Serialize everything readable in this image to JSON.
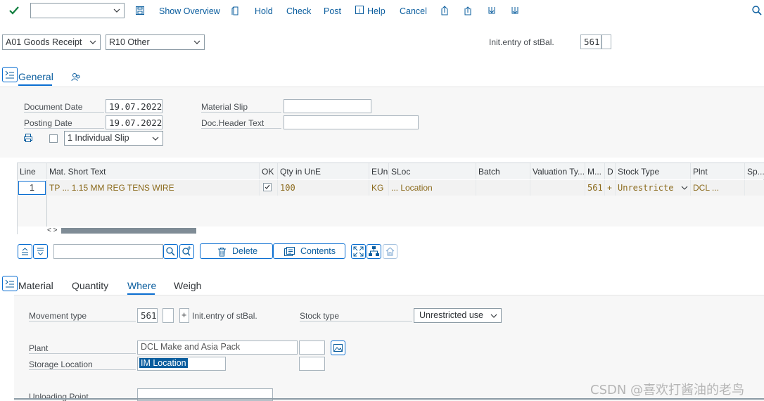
{
  "toolbar": {
    "show_overview": "Show Overview",
    "hold": "Hold",
    "check": "Check",
    "post": "Post",
    "help": "Help",
    "cancel": "Cancel"
  },
  "header": {
    "transaction": "A01 Goods Receipt",
    "reference": "R10 Other",
    "init_entry_label": "Init.entry of stBal.",
    "movement_type": "561"
  },
  "general_tab": {
    "label": "General",
    "document_date_label": "Document Date",
    "document_date": "19.07.2022",
    "posting_date_label": "Posting Date",
    "posting_date": "19.07.2022",
    "material_slip_label": "Material Slip",
    "doc_header_text_label": "Doc.Header Text",
    "slip_option": "1 Individual Slip"
  },
  "grid": {
    "columns": [
      "Line",
      "Mat. Short Text",
      "OK",
      "Qty in UnE",
      "EUn",
      "SLoc",
      "Batch",
      "Valuation Ty...",
      "M...",
      "D",
      "Stock Type",
      "Plnt",
      "Sp..."
    ],
    "row": {
      "line": "1",
      "short_text": "TP ... 1.15 MM REG TENS WIRE",
      "ok": "☑",
      "qty": "100",
      "eun": "KG",
      "sloc": "... Location",
      "mvt": "561",
      "d": "+",
      "stock_type": "Unrestricte",
      "plnt": "DCL ..."
    }
  },
  "grid_toolbar": {
    "delete": "Delete",
    "contents": "Contents"
  },
  "detail_tabs": {
    "material": "Material",
    "quantity": "Quantity",
    "where": "Where",
    "weigh": "Weigh"
  },
  "where": {
    "movement_type_label": "Movement type",
    "movement_type": "561",
    "plus": "+",
    "init_entry_label": "Init.entry of stBal.",
    "stock_type_label": "Stock type",
    "stock_type": "Unrestricted use",
    "plant_label": "Plant",
    "plant_name": "DCL Make and Asia Pack",
    "storage_location_label": "Storage Location",
    "storage_location": "IM Location",
    "unloading_point_label": "Unloading Point"
  },
  "watermark": "CSDN @喜欢打酱油的老鸟",
  "colors": {
    "accent": "#0a6ed1",
    "link": "#0a5d9e",
    "row_text": "#8b6a1c",
    "check_green": "#107e3e"
  }
}
